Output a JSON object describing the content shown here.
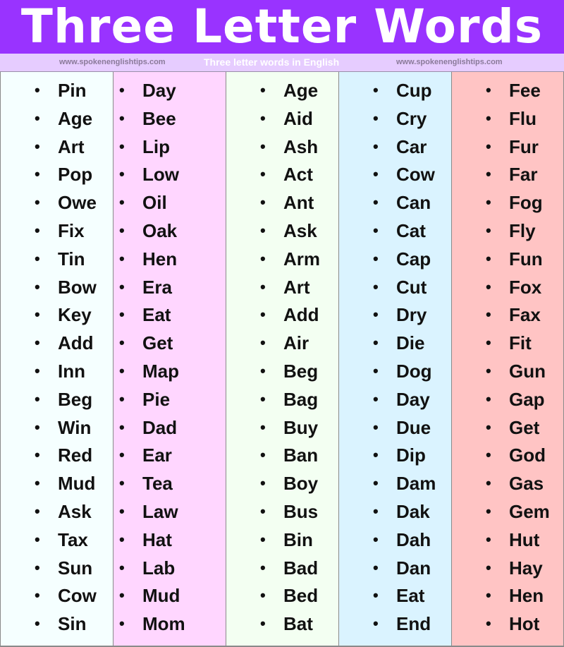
{
  "header": {
    "title": "Three Letter Words",
    "background": "#9933ff"
  },
  "subbar": {
    "site_left": "www.spokenenglishtips.com",
    "tagline": "Three letter words in English",
    "site_right": "www.spokenenglishtips.com",
    "background": "#e6ccff"
  },
  "columns": [
    {
      "color": "#f5ffff",
      "words": [
        "Pin",
        "Age",
        "Art",
        "Pop",
        "Owe",
        "Fix",
        "Tin",
        "Bow",
        "Key",
        "Add",
        "Inn",
        "Beg",
        "Win",
        "Red",
        "Mud",
        "Ask",
        "Tax",
        "Sun",
        "Cow",
        "Sin"
      ]
    },
    {
      "color": "#ffd6ff",
      "words": [
        "Day",
        "Bee",
        "Lip",
        "Low",
        "Oil",
        "Oak",
        "Hen",
        "Era",
        "Eat",
        "Get",
        "Map",
        "Pie",
        "Dad",
        "Ear",
        "Tea",
        "Law",
        "Hat",
        "Lab",
        "Mud",
        "Mom"
      ]
    },
    {
      "color": "#f3fff2",
      "words": [
        "Age",
        "Aid",
        "Ash",
        "Act",
        "Ant",
        "Ask",
        "Arm",
        "Art",
        "Add",
        "Air",
        "Beg",
        "Bag",
        "Buy",
        "Ban",
        "Boy",
        "Bus",
        "Bin",
        "Bad",
        "Bed",
        "Bat"
      ]
    },
    {
      "color": "#daf3ff",
      "words": [
        "Cup",
        "Cry",
        "Car",
        "Cow",
        "Can",
        "Cat",
        "Cap",
        "Cut",
        "Dry",
        "Die",
        "Dog",
        "Day",
        "Due",
        "Dip",
        "Dam",
        "Dak",
        "Dah",
        "Dan",
        "Eat",
        "End"
      ]
    },
    {
      "color": "#ffc4c4",
      "words": [
        "Fee",
        "Flu",
        "Fur",
        "Far",
        "Fog",
        "Fly",
        "Fun",
        "Fox",
        "Fax",
        "Fit",
        "Gun",
        "Gap",
        "Get",
        "God",
        "Gas",
        "Gem",
        "Hut",
        "Hay",
        "Hen",
        "Hot"
      ]
    }
  ],
  "bullet": "•"
}
